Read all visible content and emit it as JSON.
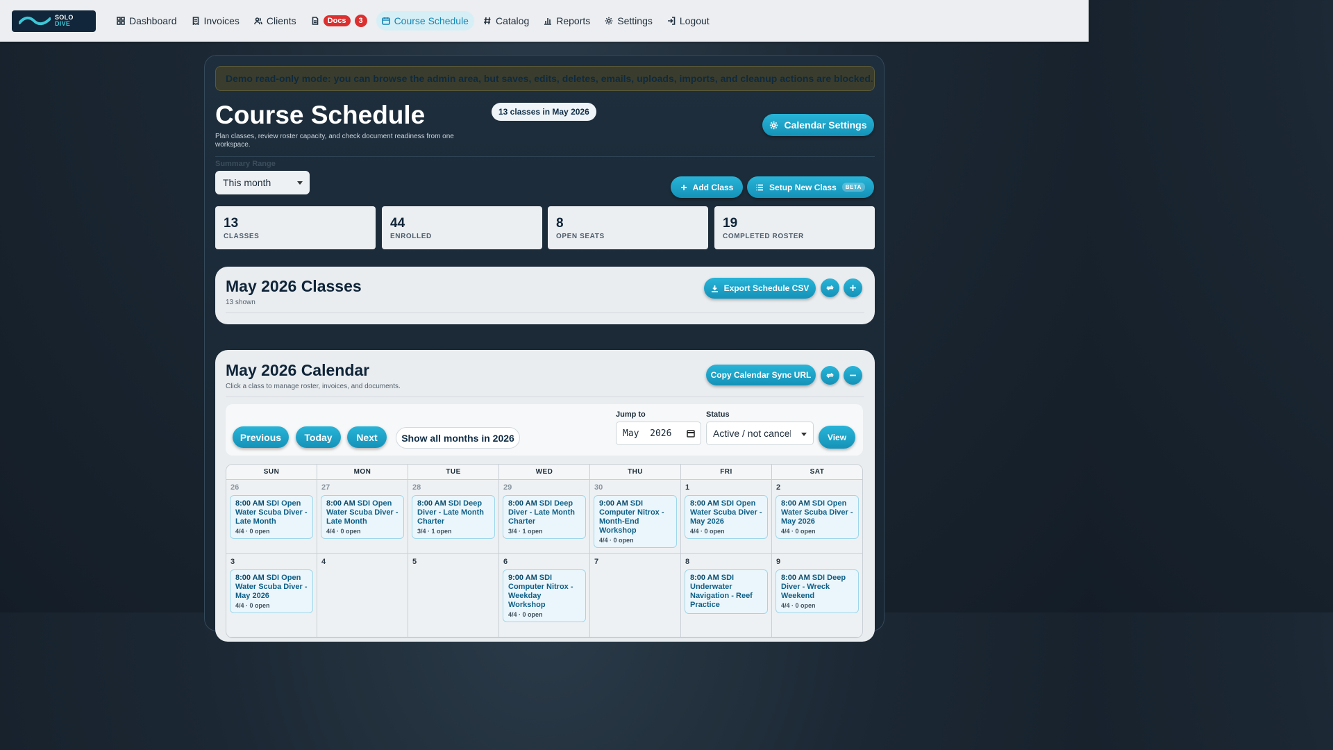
{
  "brand": {
    "line1": "SOLO",
    "line2": "DIVE"
  },
  "nav": {
    "dashboard": "Dashboard",
    "invoices": "Invoices",
    "clients": "Clients",
    "docs": "Docs",
    "docs_count": "3",
    "schedule": "Course Schedule",
    "catalog": "Catalog",
    "reports": "Reports",
    "settings": "Settings",
    "logout": "Logout"
  },
  "demo_notice": "Demo read-only mode: you can browse the admin area, but saves, edits, deletes, emails, uploads, imports, and cleanup actions are blocked.",
  "page": {
    "title": "Course Schedule",
    "subtitle": "Plan classes, review roster capacity, and check document readiness from one workspace.",
    "range_badge": "13 classes in May 2026",
    "calendar_settings": "Calendar Settings"
  },
  "summary": {
    "label": "Summary Range",
    "selected": "This month",
    "add_class": "Add Class",
    "setup_class": "Setup New Class",
    "beta": "BETA",
    "stats": [
      {
        "value": "13",
        "label": "CLASSES"
      },
      {
        "value": "44",
        "label": "ENROLLED"
      },
      {
        "value": "8",
        "label": "OPEN SEATS"
      },
      {
        "value": "19",
        "label": "COMPLETED ROSTER"
      }
    ]
  },
  "classes_card": {
    "title": "May 2026 Classes",
    "subtitle": "13 shown",
    "export": "Export Schedule CSV"
  },
  "calendar_card": {
    "title": "May 2026 Calendar",
    "subtitle": "Click a class to manage roster, invoices, and documents.",
    "copy_sync": "Copy Calendar Sync URL",
    "previous": "Previous",
    "today": "Today",
    "next": "Next",
    "show_all": "Show all months in 2026",
    "jump_label": "Jump to",
    "jump_value": "May  2026",
    "status_label": "Status",
    "status_value": "Active / not cancelled",
    "view": "View",
    "days_of_week": [
      "SUN",
      "MON",
      "TUE",
      "WED",
      "THU",
      "FRI",
      "SAT"
    ]
  },
  "weeks": [
    [
      {
        "num": "26",
        "out": true,
        "events": [
          {
            "time": "8:00 AM",
            "title": "SDI Open Water Scuba Diver - Late Month",
            "meta": "4/4 · 0 open"
          }
        ]
      },
      {
        "num": "27",
        "out": true,
        "events": [
          {
            "time": "8:00 AM",
            "title": "SDI Open Water Scuba Diver - Late Month",
            "meta": "4/4 · 0 open"
          }
        ]
      },
      {
        "num": "28",
        "out": true,
        "events": [
          {
            "time": "8:00 AM",
            "title": "SDI Deep Diver - Late Month Charter",
            "meta": "3/4 · 1 open"
          }
        ]
      },
      {
        "num": "29",
        "out": true,
        "events": [
          {
            "time": "8:00 AM",
            "title": "SDI Deep Diver - Late Month Charter",
            "meta": "3/4 · 1 open"
          }
        ]
      },
      {
        "num": "30",
        "out": true,
        "events": [
          {
            "time": "9:00 AM",
            "title": "SDI Computer Nitrox - Month-End Workshop",
            "meta": "4/4 · 0 open"
          }
        ]
      },
      {
        "num": "1",
        "out": false,
        "events": [
          {
            "time": "8:00 AM",
            "title": "SDI Open Water Scuba Diver - May 2026",
            "meta": "4/4 · 0 open"
          }
        ]
      },
      {
        "num": "2",
        "out": false,
        "events": [
          {
            "time": "8:00 AM",
            "title": "SDI Open Water Scuba Diver - May 2026",
            "meta": "4/4 · 0 open"
          }
        ]
      }
    ],
    [
      {
        "num": "3",
        "out": false,
        "events": [
          {
            "time": "8:00 AM",
            "title": "SDI Open Water Scuba Diver - May 2026",
            "meta": "4/4 · 0 open"
          }
        ]
      },
      {
        "num": "4",
        "out": false,
        "events": []
      },
      {
        "num": "5",
        "out": false,
        "events": []
      },
      {
        "num": "6",
        "out": false,
        "events": [
          {
            "time": "9:00 AM",
            "title": "SDI Computer Nitrox - Weekday Workshop",
            "meta": "4/4 · 0 open"
          }
        ]
      },
      {
        "num": "7",
        "out": false,
        "events": []
      },
      {
        "num": "8",
        "out": false,
        "events": [
          {
            "time": "8:00 AM",
            "title": "SDI Underwater Navigation - Reef Practice",
            "meta": ""
          }
        ]
      },
      {
        "num": "9",
        "out": false,
        "events": [
          {
            "time": "8:00 AM",
            "title": "SDI Deep Diver - Wreck Weekend",
            "meta": "4/4 · 0 open"
          }
        ]
      }
    ]
  ]
}
